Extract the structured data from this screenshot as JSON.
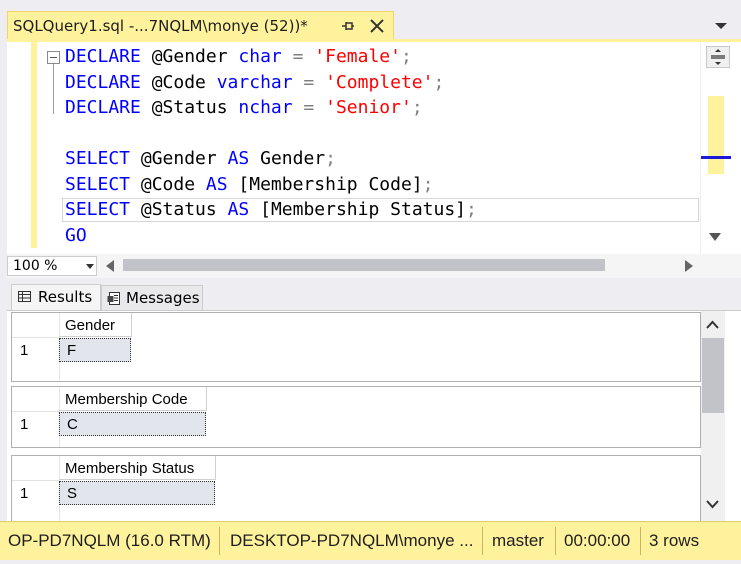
{
  "tab": {
    "title": "SQLQuery1.sql -...7NQLM\\monye (52))*"
  },
  "editor": {
    "lines": [
      [
        {
          "t": "DECLARE",
          "c": "kw"
        },
        {
          "t": " @Gender ",
          "c": ""
        },
        {
          "t": "char",
          "c": "kw"
        },
        {
          "t": " = ",
          "c": "op"
        },
        {
          "t": "'Female'",
          "c": "str"
        },
        {
          "t": ";",
          "c": "op"
        }
      ],
      [
        {
          "t": "DECLARE",
          "c": "kw"
        },
        {
          "t": " @Code ",
          "c": ""
        },
        {
          "t": "varchar",
          "c": "kw"
        },
        {
          "t": " = ",
          "c": "op"
        },
        {
          "t": "'Complete'",
          "c": "str"
        },
        {
          "t": ";",
          "c": "op"
        }
      ],
      [
        {
          "t": "DECLARE",
          "c": "kw"
        },
        {
          "t": " @Status ",
          "c": ""
        },
        {
          "t": "nchar",
          "c": "kw"
        },
        {
          "t": " = ",
          "c": "op"
        },
        {
          "t": "'Senior'",
          "c": "str"
        },
        {
          "t": ";",
          "c": "op"
        }
      ],
      [],
      [
        {
          "t": "SELECT",
          "c": "kw"
        },
        {
          "t": " @Gender ",
          "c": ""
        },
        {
          "t": "AS",
          "c": "kw"
        },
        {
          "t": " Gender",
          "c": ""
        },
        {
          "t": ";",
          "c": "op"
        }
      ],
      [
        {
          "t": "SELECT",
          "c": "kw"
        },
        {
          "t": " @Code ",
          "c": ""
        },
        {
          "t": "AS",
          "c": "kw"
        },
        {
          "t": " [Membership Code]",
          "c": ""
        },
        {
          "t": ";",
          "c": "op"
        }
      ],
      [
        {
          "t": "SELECT",
          "c": "kw"
        },
        {
          "t": " @Status ",
          "c": ""
        },
        {
          "t": "AS",
          "c": "kw"
        },
        {
          "t": " [Membership Status]",
          "c": ""
        },
        {
          "t": ";",
          "c": "op"
        }
      ],
      [
        {
          "t": "GO",
          "c": "kw"
        }
      ]
    ]
  },
  "zoom": {
    "value": "100 %"
  },
  "results_tabs": {
    "results_label": "Results",
    "messages_label": "Messages"
  },
  "result_grids": [
    {
      "header": "Gender",
      "row_number": "1",
      "value": "F"
    },
    {
      "header": "Membership Code",
      "row_number": "1",
      "value": "C"
    },
    {
      "header": "Membership Status",
      "row_number": "1",
      "value": "S"
    }
  ],
  "status": {
    "server": "OP-PD7NQLM (16.0 RTM)",
    "user": "DESKTOP-PD7NQLM\\monye ...",
    "database": "master",
    "elapsed": "00:00:00",
    "rows": "3 rows"
  },
  "colors": {
    "accent": "#fff29d",
    "keyword": "#0000ff",
    "string": "#ff0000",
    "operator": "#808080"
  },
  "icons": [
    "pin-icon",
    "close-icon",
    "dropdown-icon",
    "split-icon",
    "grid-icon",
    "messages-icon"
  ]
}
